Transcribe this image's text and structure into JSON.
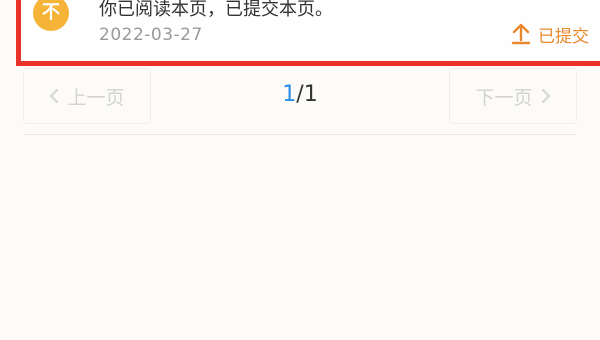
{
  "record": {
    "avatar_char": "不",
    "title": "你已阅读本页，已提交本页。",
    "date": "2022-03-27",
    "status_label": "已提交",
    "status_icon": "upload-icon",
    "highlight_color": "#e8322a",
    "avatar_color": "#f5b338",
    "status_color": "#e8892d"
  },
  "pagination": {
    "prev_label": "上一页",
    "next_label": "下一页",
    "prev_icon": "chevron-left-icon",
    "next_icon": "chevron-right-icon",
    "current_page": "1",
    "separator": "/",
    "total_pages": "1",
    "current_color": "#2a8de8"
  }
}
